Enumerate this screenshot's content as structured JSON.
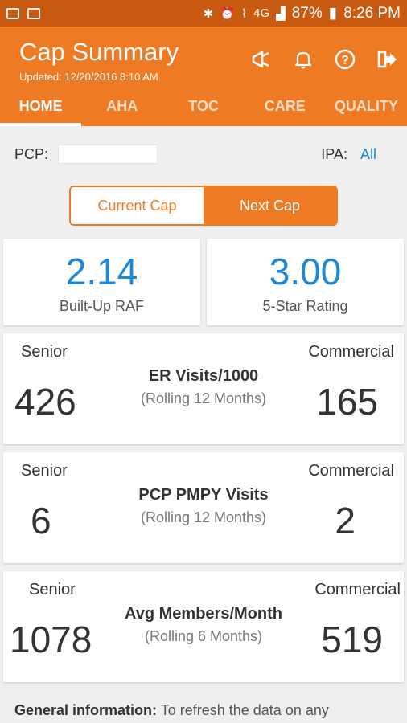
{
  "status_bar": {
    "battery": "87%",
    "time": "8:26 PM",
    "network": "4G"
  },
  "app_bar": {
    "title": "Cap Summary",
    "updated": "Updated: 12/20/2016 8:10 AM",
    "actions": [
      "megaphone-icon",
      "bell-icon",
      "help-icon",
      "logout-icon"
    ]
  },
  "tabs": [
    {
      "label": "HOME",
      "active": true
    },
    {
      "label": "AHA"
    },
    {
      "label": "TOC"
    },
    {
      "label": "CARE"
    },
    {
      "label": "QUALITY"
    }
  ],
  "pcp": {
    "label": "PCP:",
    "value": ""
  },
  "ipa": {
    "label": "IPA:",
    "value": "All"
  },
  "toggle": {
    "current": "Current Cap",
    "next": "Next Cap",
    "selected": "Next Cap"
  },
  "metrics": [
    {
      "value": "2.14",
      "label": "Built-Up RAF"
    },
    {
      "value": "3.00",
      "label": "5-Star Rating"
    }
  ],
  "cards": [
    {
      "senior_label": "Senior",
      "commercial_label": "Commercial",
      "title": "ER Visits/1000",
      "subtitle": "(Rolling 12 Months)",
      "senior_value": "426",
      "commercial_value": "165"
    },
    {
      "senior_label": "Senior",
      "commercial_label": "Commercial",
      "title": "PCP PMPY Visits",
      "subtitle": "(Rolling 12 Months)",
      "senior_value": "6",
      "commercial_value": "2"
    },
    {
      "senior_label": "Senior",
      "commercial_label": "Commercial",
      "title": "Avg Members/Month",
      "subtitle": "(Rolling 6 Months)",
      "senior_value": "1078",
      "commercial_value": "519"
    }
  ],
  "general_info": {
    "label": "General information:",
    "text": "To refresh the data on any"
  },
  "colors": {
    "primary": "#ef7a24",
    "status_bar": "#c85a12",
    "accent_blue": "#1e88d8"
  }
}
